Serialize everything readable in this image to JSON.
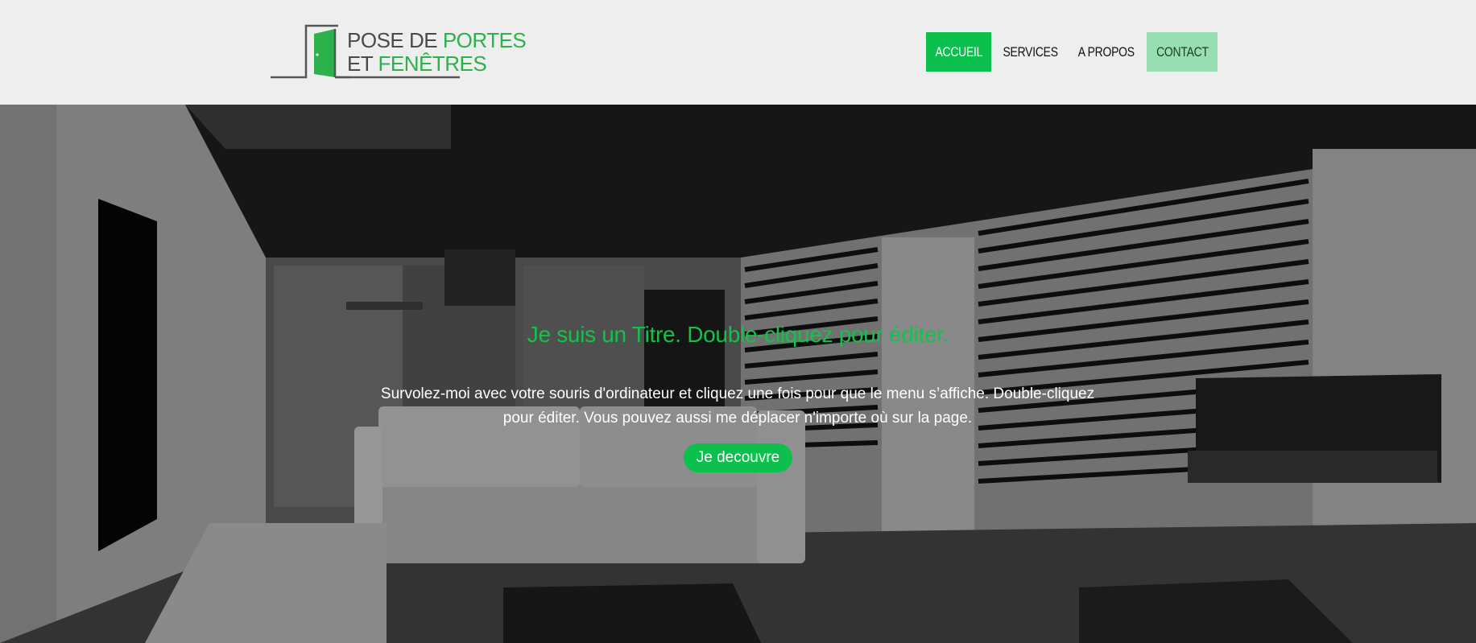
{
  "logo": {
    "line1_a": "POSE DE ",
    "line1_b": "PORTES",
    "line2_a": "ET ",
    "line2_b": "FENÊTRES",
    "accent": "#2bb24c",
    "icon": "door-icon"
  },
  "nav": {
    "items": [
      {
        "label": "ACCUEIL",
        "state": "active"
      },
      {
        "label": "SERVICES",
        "state": "normal"
      },
      {
        "label": "A PROPOS",
        "state": "normal"
      },
      {
        "label": "CONTACT",
        "state": "highlight"
      }
    ],
    "active_color": "#0bc04d",
    "contact_color": "#97dfb2"
  },
  "hero": {
    "title": "Je suis un Titre. Double-cliquez pour éditer.",
    "text": "Survolez-moi avec votre souris d'ordinateur et cliquez une fois pour que le menu s’affiche. Double-cliquez pour éditer. Vous pouvez aussi me déplacer n'importe où sur la page.",
    "button_label": "Je decouvre",
    "title_color": "#14c24a",
    "button_color": "#0bc04d"
  }
}
